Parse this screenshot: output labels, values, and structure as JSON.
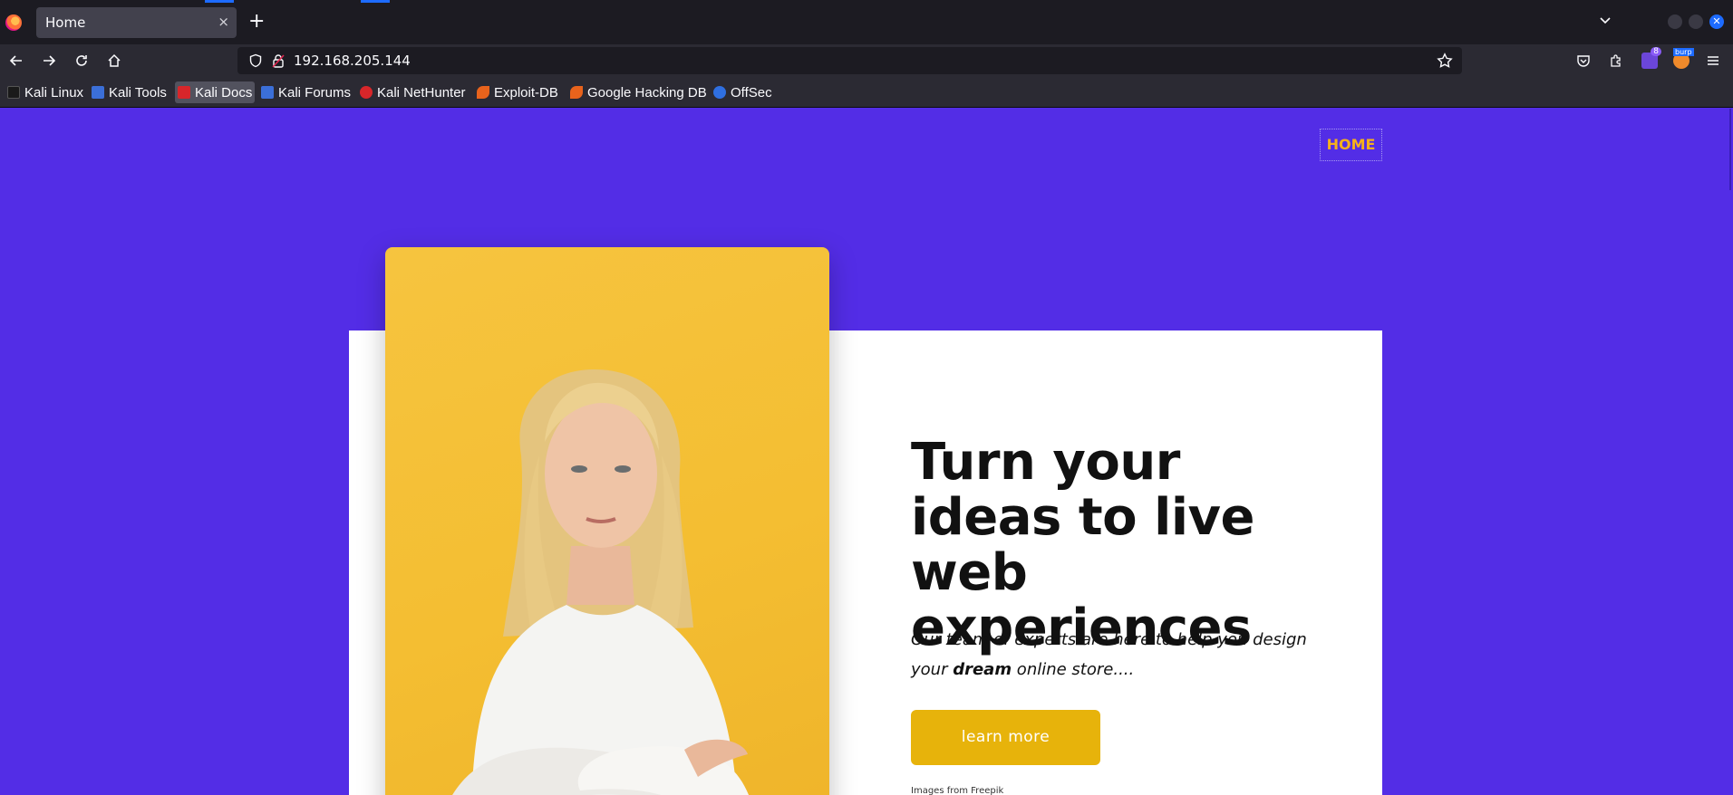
{
  "browser": {
    "tab": {
      "title": "Home",
      "close_glyph": "×"
    },
    "new_tab_glyph": "+",
    "url": "192.168.205.144",
    "bookmarks": [
      {
        "label": "Kali Linux",
        "icon": "kali-dragon-icon",
        "color": "#1a1a1a"
      },
      {
        "label": "Kali Tools",
        "icon": "kali-tools-icon",
        "color": "#3b6fd8"
      },
      {
        "label": "Kali Docs",
        "icon": "kali-docs-icon",
        "color": "#d8262a"
      },
      {
        "label": "Kali Forums",
        "icon": "kali-forums-icon",
        "color": "#3b6fd8"
      },
      {
        "label": "Kali NetHunter",
        "icon": "nethunter-icon",
        "color": "#d8262a"
      },
      {
        "label": "Exploit-DB",
        "icon": "exploit-db-icon",
        "color": "#e8631c"
      },
      {
        "label": "Google Hacking DB",
        "icon": "ghdb-icon",
        "color": "#e8631c"
      },
      {
        "label": "OffSec",
        "icon": "offsec-icon",
        "color": "#2f6fe0"
      }
    ],
    "extension_badge": "8",
    "burp_label": "burp"
  },
  "site": {
    "nav": {
      "home": "HOME"
    },
    "hero": {
      "headline": "Turn your ideas to live web experiences",
      "sub_part1": "Our team of experts are here to help you design your ",
      "sub_bold": "dream",
      "sub_part2": " online store....",
      "cta": "learn more",
      "credit": "Images from Freepik"
    }
  },
  "colors": {
    "page_bg": "#532de6",
    "card_bg": "#ffffff",
    "photo_bg": "#f4be32",
    "accent": "#f6b11b",
    "cta_bg": "#e7b30b"
  }
}
